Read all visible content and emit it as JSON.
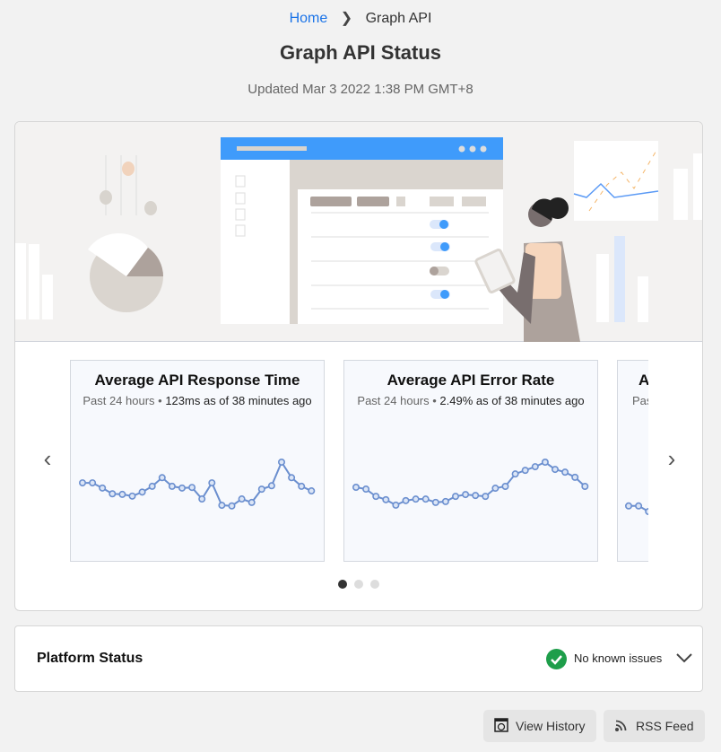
{
  "breadcrumb": {
    "home": "Home",
    "current": "Graph API"
  },
  "title": "Graph API Status",
  "updated": "Updated Mar 3 2022 1:38 PM GMT+8",
  "carousel": {
    "cards": [
      {
        "title": "Average API Response Time",
        "period": "Past 24 hours",
        "sep": " • ",
        "value": "123ms as of 38 minutes ago"
      },
      {
        "title": "Average API Error Rate",
        "period": "Past 24 hours",
        "sep": " • ",
        "value": "2.49% as of 38 minutes ago"
      },
      {
        "title": "A",
        "period": "Pas"
      }
    ],
    "pages": 3,
    "active_page": 1
  },
  "chart_data": [
    {
      "type": "line",
      "title": "Average API Response Time",
      "unit": "ms",
      "color": "#6b8fcf",
      "values": [
        137,
        137,
        128,
        118,
        117,
        114,
        121,
        131,
        146,
        131,
        128,
        129,
        109,
        137,
        98,
        97,
        109,
        103,
        126,
        132,
        173,
        146,
        131,
        123
      ]
    },
    {
      "type": "line",
      "title": "Average API Error Rate",
      "unit": "%",
      "color": "#6b8fcf",
      "values": [
        2.46,
        2.4,
        2.16,
        2.05,
        1.87,
        2.02,
        2.07,
        2.07,
        1.96,
        1.99,
        2.16,
        2.22,
        2.19,
        2.16,
        2.43,
        2.49,
        2.9,
        3.02,
        3.14,
        3.29,
        3.05,
        2.96,
        2.79,
        2.49
      ]
    },
    {
      "type": "line",
      "title": "A",
      "color": "#6b8fcf",
      "values": [
        1,
        1,
        0.9
      ]
    }
  ],
  "platform": {
    "label": "Platform Status",
    "status": "No known issues",
    "status_color": "#1e9e4a"
  },
  "buttons": {
    "history": "View History",
    "rss": "RSS Feed"
  },
  "icons": {
    "prev": "chevron-left-icon",
    "next": "chevron-right-icon",
    "history": "history-icon",
    "rss": "rss-icon"
  }
}
